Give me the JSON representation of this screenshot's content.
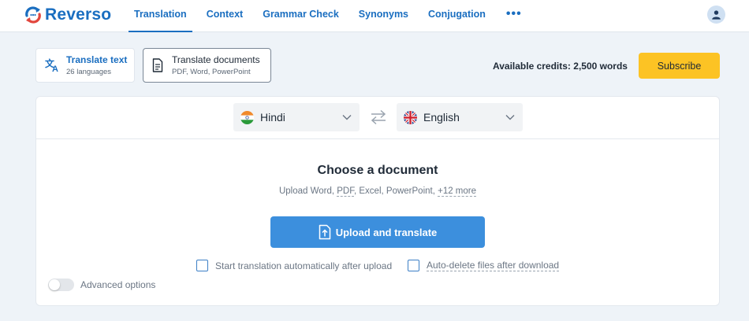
{
  "header": {
    "brand": "Reverso",
    "brand_color": "#1a6ec0",
    "nav": [
      {
        "label": "Translation",
        "active": true
      },
      {
        "label": "Context",
        "active": false
      },
      {
        "label": "Grammar Check",
        "active": false
      },
      {
        "label": "Synonyms",
        "active": false
      },
      {
        "label": "Conjugation",
        "active": false
      }
    ],
    "more_label": "•••",
    "avatar_icon": "user-icon"
  },
  "modes": {
    "text": {
      "title": "Translate text",
      "subtitle": "26 languages",
      "icon": "translate-icon"
    },
    "documents": {
      "title": "Translate documents",
      "subtitle": "PDF, Word, PowerPoint",
      "icon": "document-icon",
      "selected": true
    }
  },
  "account": {
    "credits": "Available credits: 2,500 words",
    "subscribe_label": "Subscribe",
    "subscribe_color": "#fcc324"
  },
  "languages": {
    "source": {
      "name": "Hindi",
      "flag": "india-flag-icon"
    },
    "target": {
      "name": "English",
      "flag": "uk-flag-icon"
    },
    "swap_icon": "swap-icon"
  },
  "upload": {
    "title": "Choose a document",
    "formats_prefix": "Upload Word, ",
    "formats_pdf": "PDF",
    "formats_rest": ", Excel, PowerPoint, ",
    "formats_more": "+12 more",
    "button_label": "Upload and translate",
    "button_color": "#3c8fdd",
    "auto_start_label": "Start translation automatically after upload",
    "auto_start_checked": false,
    "auto_delete_label": "Auto-delete files after download",
    "auto_delete_checked": false,
    "advanced_label": "Advanced options",
    "advanced_on": false
  }
}
